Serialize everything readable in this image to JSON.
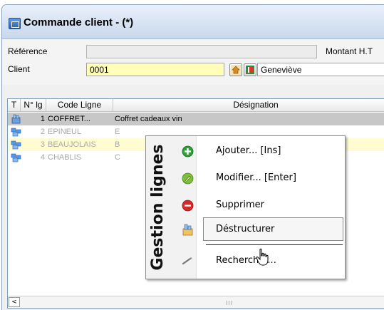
{
  "window": {
    "title": "Commande client -  (*)",
    "accent": "#c9d8ec"
  },
  "header": {
    "reference_label": "Référence",
    "reference_value": "",
    "montant_label": "Montant H.T",
    "client_label": "Client",
    "client_code": "0001",
    "client_name": "Geneviève",
    "client_field_color": "#ffffb9"
  },
  "grid": {
    "columns": [
      "T",
      "N° lg",
      "Code Ligne",
      "Désignation"
    ],
    "rows": [
      {
        "icon": "product-icon",
        "num": "1",
        "code": "COFFRET...",
        "designation": "Coffret cadeaux vin",
        "state": "selected"
      },
      {
        "icon": "component-icon",
        "num": "2",
        "code": "EPINEUL",
        "designation": "E",
        "state": "faded"
      },
      {
        "icon": "component-icon",
        "num": "3",
        "code": "BEAUJOLAIS",
        "designation": "B",
        "state": "highlighted"
      },
      {
        "icon": "component-icon",
        "num": "4",
        "code": "CHABLIS",
        "designation": "C",
        "state": "faded"
      }
    ],
    "scroll_left": "<",
    "scroll_grip": "III"
  },
  "context_menu": {
    "side_title": "Gestion lignes",
    "items": [
      {
        "label": "Ajouter... [Ins]",
        "icon": "add-icon",
        "color": "#2e9e3a"
      },
      {
        "label": "Modifier... [Enter]",
        "icon": "edit-icon",
        "color": "#7cbf3a"
      },
      {
        "label": "Supprimer",
        "icon": "delete-icon",
        "color": "#d02a2a"
      },
      {
        "label": "Déstructurer",
        "icon": "unstructure-icon",
        "color": "#e9b64a"
      },
      {
        "label": "Rechercher...",
        "icon": "search-icon",
        "color": "#888888"
      }
    ],
    "hover_index": 3
  }
}
